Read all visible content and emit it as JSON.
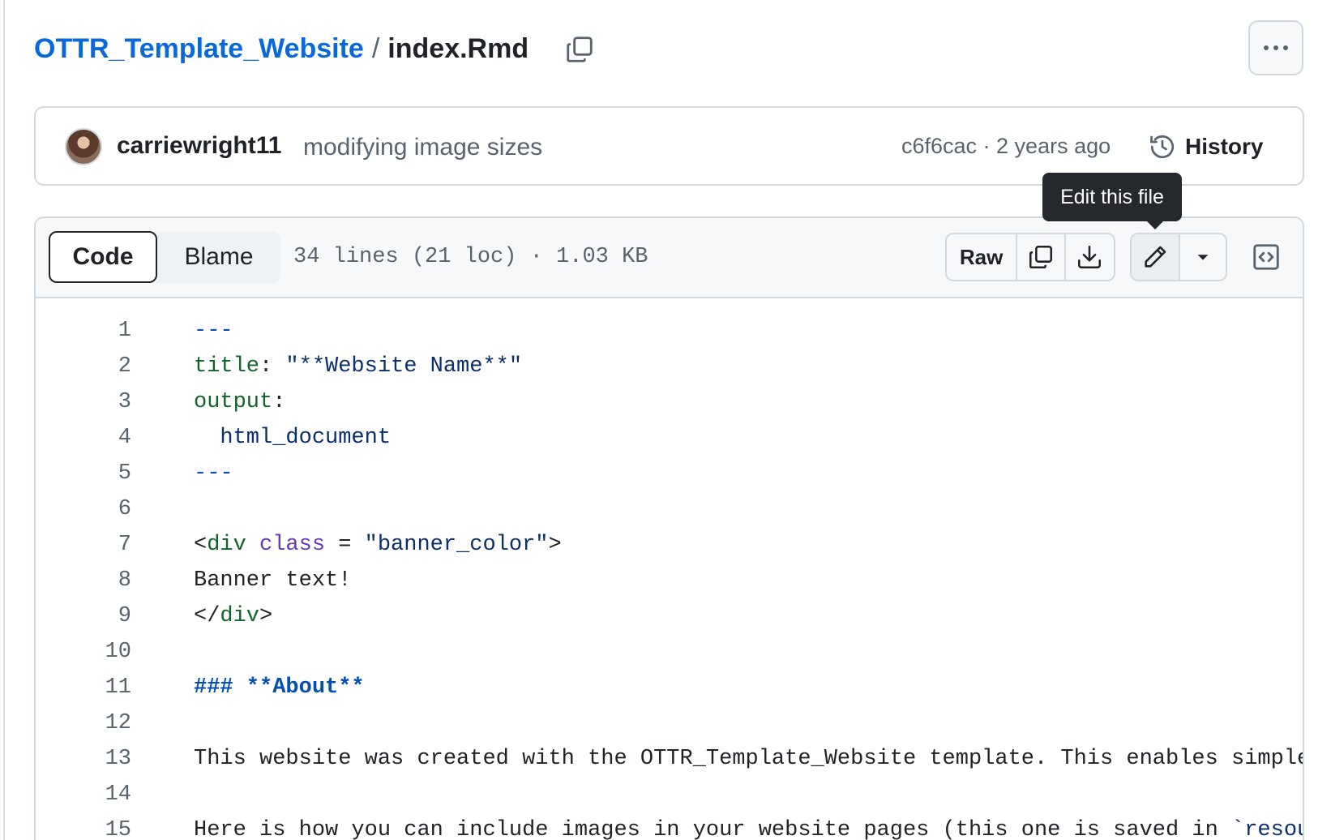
{
  "breadcrumb": {
    "repo": "OTTR_Template_Website",
    "separator": "/",
    "file": "index.Rmd"
  },
  "commit": {
    "author": "carriewright11",
    "message": "modifying image sizes",
    "meta": "c6f6cac · 2 years ago",
    "history_label": "History"
  },
  "tooltip": {
    "text": "Edit this file"
  },
  "file_header": {
    "code_tab": "Code",
    "blame_tab": "Blame",
    "info": "34 lines (21 loc) · 1.03 KB",
    "raw_label": "Raw"
  },
  "icons": {
    "copy_path": "copy-icon",
    "more": "kebab-horizontal-icon",
    "history": "history-icon",
    "copy_raw": "copy-icon",
    "download": "download-icon",
    "edit": "pencil-icon",
    "dropdown": "triangle-down-icon",
    "symbols": "code-square-icon"
  },
  "colors": {
    "link": "#0969da",
    "tooltip_bg": "#25292e",
    "border": "#d1d9e0"
  },
  "code": {
    "lines": [
      {
        "num": "1",
        "parts": [
          {
            "t": "---",
            "c": "c-dash"
          }
        ]
      },
      {
        "num": "2",
        "parts": [
          {
            "t": "title",
            "c": "c-key"
          },
          {
            "t": ": ",
            "c": ""
          },
          {
            "t": "\"**Website Name**\"",
            "c": "c-str"
          }
        ]
      },
      {
        "num": "3",
        "parts": [
          {
            "t": "output",
            "c": "c-key"
          },
          {
            "t": ":",
            "c": ""
          }
        ]
      },
      {
        "num": "4",
        "parts": [
          {
            "t": "  ",
            "c": ""
          },
          {
            "t": "html_document",
            "c": "c-str"
          }
        ]
      },
      {
        "num": "5",
        "parts": [
          {
            "t": "---",
            "c": "c-dash"
          }
        ]
      },
      {
        "num": "6",
        "parts": []
      },
      {
        "num": "7",
        "parts": [
          {
            "t": "<",
            "c": ""
          },
          {
            "t": "div",
            "c": "c-key"
          },
          {
            "t": " ",
            "c": ""
          },
          {
            "t": "class",
            "c": "c-attr"
          },
          {
            "t": " = ",
            "c": ""
          },
          {
            "t": "\"banner_color\"",
            "c": "c-str"
          },
          {
            "t": ">",
            "c": ""
          }
        ]
      },
      {
        "num": "8",
        "parts": [
          {
            "t": "Banner text!",
            "c": ""
          }
        ]
      },
      {
        "num": "9",
        "parts": [
          {
            "t": "</",
            "c": ""
          },
          {
            "t": "div",
            "c": "c-key"
          },
          {
            "t": ">",
            "c": ""
          }
        ]
      },
      {
        "num": "10",
        "parts": []
      },
      {
        "num": "11",
        "parts": [
          {
            "t": "### **About**",
            "c": "c-head"
          }
        ]
      },
      {
        "num": "12",
        "parts": []
      },
      {
        "num": "13",
        "parts": [
          {
            "t": "This website was created with the OTTR_Template_Website template. This enables simpler",
            "c": ""
          }
        ]
      },
      {
        "num": "14",
        "parts": []
      },
      {
        "num": "15",
        "parts": [
          {
            "t": "Here is how you can include images in your website pages (this one is saved in ",
            "c": ""
          },
          {
            "t": "`resour",
            "c": "c-str"
          }
        ]
      }
    ]
  }
}
